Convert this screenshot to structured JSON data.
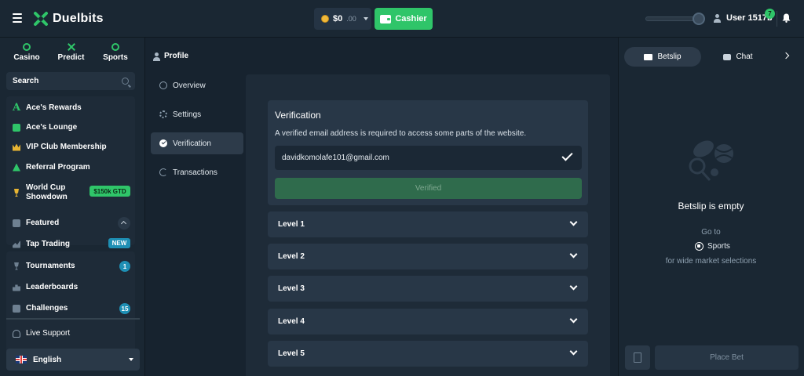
{
  "header": {
    "logo_text": "Duelbits",
    "balance": "$0",
    "balance_cents": ".00",
    "cashier_label": "Cashier",
    "username": "User 1517b",
    "user_level": "7",
    "accent_color": "#2fc569"
  },
  "sidebar": {
    "categories": [
      {
        "label": "Casino",
        "icon": "cherries-icon"
      },
      {
        "label": "Predict",
        "icon": "crossed-swords-icon"
      },
      {
        "label": "Sports",
        "icon": "soccer-ball-icon"
      }
    ],
    "search_label": "Search",
    "promo_items": [
      {
        "label": "Ace's Rewards",
        "icon": "ace-icon"
      },
      {
        "label": "Ace's Lounge",
        "icon": "lounge-icon"
      },
      {
        "label": "VIP Club Membership",
        "icon": "crown-icon"
      },
      {
        "label": "Referral Program",
        "icon": "referral-icon"
      },
      {
        "label": "World Cup Showdown",
        "label_line1": "World Cup",
        "label_line2": "Showdown",
        "icon": "trophy-icon",
        "badge": "$150k GTD"
      }
    ],
    "featured_label": "Featured",
    "featured_items": [
      {
        "label": "Tap Trading",
        "icon": "chart-icon",
        "badge": "NEW"
      },
      {
        "label": "Tournaments",
        "icon": "trophy-icon",
        "badge": "1"
      },
      {
        "label": "Leaderboards",
        "icon": "leaderboard-icon"
      },
      {
        "label": "Challenges",
        "icon": "puzzle-icon",
        "badge": "15"
      }
    ],
    "live_support_label": "Live Support",
    "language_label": "English"
  },
  "profile": {
    "heading": "Profile",
    "nav": [
      {
        "label": "Overview",
        "icon": "globe-icon",
        "active": false
      },
      {
        "label": "Settings",
        "icon": "gear-icon",
        "active": false
      },
      {
        "label": "Verification",
        "icon": "check-circle-icon",
        "active": true
      },
      {
        "label": "Transactions",
        "icon": "history-icon",
        "active": false
      }
    ]
  },
  "verification": {
    "title": "Verification",
    "description": "A verified email address is required to access some parts of the website.",
    "email": "davidkomolafe101@gmail.com",
    "verified_label": "Verified",
    "levels": [
      "Level 1",
      "Level 2",
      "Level 3",
      "Level 4",
      "Level 5"
    ]
  },
  "betslip": {
    "tab_betslip": "Betslip",
    "tab_chat": "Chat",
    "empty_title": "Betslip is empty",
    "goto_text": "Go to",
    "sports_link": "Sports",
    "wide_market_text": "for wide market selections",
    "place_bet_label": "Place Bet"
  }
}
